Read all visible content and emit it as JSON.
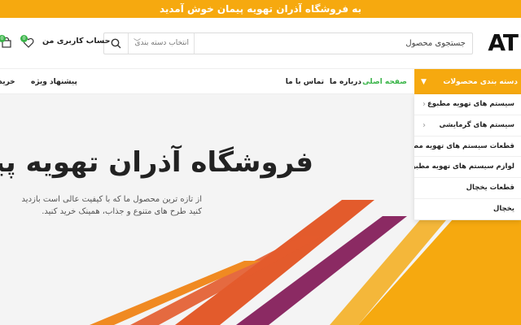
{
  "topbar": {
    "text": "به فروشگاه آذران تهویه پیمان خوش آمدید"
  },
  "header": {
    "logo": "AT",
    "search": {
      "placeholder": "جستجوی محصول",
      "category": "انتخاب دسته بندی"
    },
    "account_label": "حساب کاربری من",
    "wishlist_count": "0",
    "cart_count": "0"
  },
  "nav": {
    "categories_label": "دسته بندی محصولات",
    "links": [
      "صفحه اصلی",
      "درباره ما",
      "تماس با ما"
    ],
    "special_offer": "پیشنهاد ویژه",
    "buy": "خرید"
  },
  "dropdown": {
    "items": [
      "سیستم های تهویه مطبوع",
      "سیستم های گرمایشی",
      "قطعات سیستم های تهویه مطبوع",
      "لوازم سیستم های تهویه مطبوع",
      "قطعات یخچال",
      "یخچال"
    ]
  },
  "hero": {
    "title": "فروشگاه آذران تهویه پیمان",
    "description": "از تازه ترین محصول ما که با کیفیت عالی است بازدید کنید طرح های متنوع و جذاب، همینک خرید کنید."
  },
  "colors": {
    "accent": "#f6a90f",
    "green": "#3bb54a",
    "stripe_red": "#e35b2c",
    "stripe_purple": "#8b2a63"
  }
}
